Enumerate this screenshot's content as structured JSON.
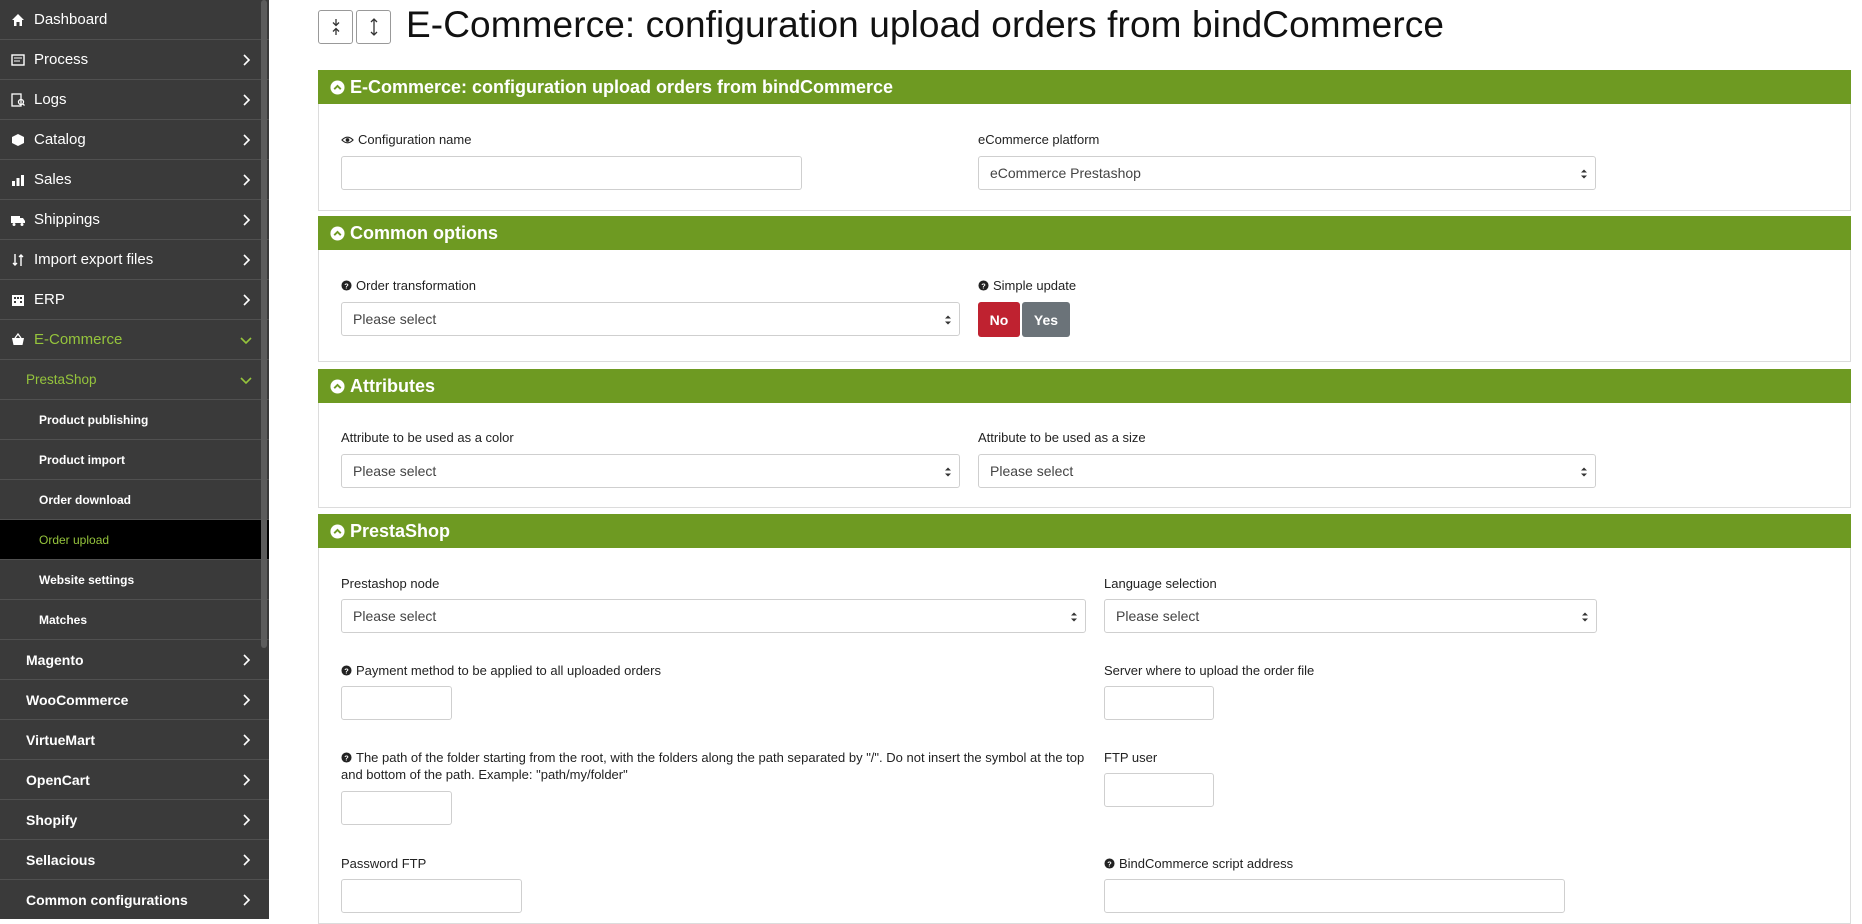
{
  "sidebar": {
    "items": [
      {
        "label": "Dashboard",
        "icon": "home-icon"
      },
      {
        "label": "Process",
        "icon": "process-icon"
      },
      {
        "label": "Logs",
        "icon": "logs-icon"
      },
      {
        "label": "Catalog",
        "icon": "box-icon"
      },
      {
        "label": "Sales",
        "icon": "chart-icon"
      },
      {
        "label": "Shippings",
        "icon": "truck-icon"
      },
      {
        "label": "Import export files",
        "icon": "sort-icon"
      },
      {
        "label": "ERP",
        "icon": "building-icon"
      },
      {
        "label": "E-Commerce",
        "icon": "basket-icon"
      }
    ],
    "prestashop": "PrestaShop",
    "subitems": [
      "Product publishing",
      "Product import",
      "Order download",
      "Order upload",
      "Website settings",
      "Matches"
    ],
    "platforms": [
      "Magento",
      "WooCommerce",
      "VirtueMart",
      "OpenCart",
      "Shopify",
      "Sellacious",
      "Common configurations"
    ],
    "active_color": "#95c43c"
  },
  "page": {
    "title": "E-Commerce: configuration upload orders from bindCommerce"
  },
  "sections": {
    "config": {
      "title": "E-Commerce: configuration upload orders from bindCommerce",
      "name_label": "Configuration name",
      "name_value": "",
      "platform_label": "eCommerce platform",
      "platform_value": "eCommerce Prestashop"
    },
    "common": {
      "title": "Common options",
      "transformation_label": "Order transformation",
      "transformation_value": "Please select",
      "simple_update_label": "Simple update",
      "no_label": "No",
      "yes_label": "Yes"
    },
    "attributes": {
      "title": "Attributes",
      "color_label": "Attribute to be used as a color",
      "color_value": "Please select",
      "size_label": "Attribute to be used as a size",
      "size_value": "Please select"
    },
    "prestashop": {
      "title": "PrestaShop",
      "node_label": "Prestashop node",
      "node_value": "Please select",
      "language_label": "Language selection",
      "language_value": "Please select",
      "payment_label": "Payment method to be applied to all uploaded orders",
      "server_label": "Server where to upload the order file",
      "path_label_line1": "The path of the folder starting from the root, with the folders along the path separated by \"/\". Do not insert the symbol at the top",
      "path_label_line2": "and bottom of the path. Example: \"path/my/folder\"",
      "ftp_user_label": "FTP user",
      "password_label": "Password FTP",
      "script_label": "BindCommerce script address"
    }
  },
  "colors": {
    "header_green": "#6e9a22",
    "sidebar_bg": "#3a3a3a",
    "no_red": "#bf2230",
    "yes_grey": "#6b7379"
  }
}
